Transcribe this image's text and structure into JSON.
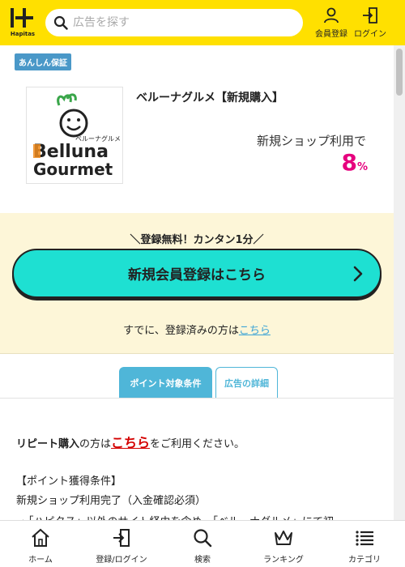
{
  "header": {
    "logo_text": "Hapitas",
    "search_placeholder": "広告を探す",
    "register_label": "会員登録",
    "login_label": "ログイン"
  },
  "ad": {
    "badge": "あんしん保証",
    "shop_name": "ベルーナグルメ【新規購入】",
    "logo": {
      "kana": "ベルーナグルメ",
      "line1": "Belluna",
      "line2": "Gourmet"
    },
    "rate_label": "新規ショップ利用で",
    "rate_value": "8",
    "rate_unit": "%"
  },
  "register": {
    "free_text": "＼登録無料！カンタン1分／",
    "button_label": "新規会員登録はこちら",
    "already_text": "すでに、登録済みの方は",
    "already_link": "こちら"
  },
  "tabs": [
    {
      "label": "ポイント対象条件",
      "active": true
    },
    {
      "label": "広告の詳細",
      "active": false
    }
  ],
  "content": {
    "repeat_strong": "リピート購入",
    "repeat_mid": "の方は",
    "repeat_link": "こちら",
    "repeat_tail": "をご利用ください。",
    "cond_heading": "【ポイント獲得条件】",
    "cond_line": "新規ショップ利用完了（入金確認必須）",
    "cond_bullet": "・「ハピタス」以外のサイト経由を含め、「ベルーナグルメ」にて初"
  },
  "bottom_nav": [
    {
      "label": "ホーム",
      "icon": "home-icon"
    },
    {
      "label": "登録/ログイン",
      "icon": "login-icon"
    },
    {
      "label": "検索",
      "icon": "search-icon"
    },
    {
      "label": "ランキング",
      "icon": "crown-icon"
    },
    {
      "label": "カテゴリ",
      "icon": "list-icon"
    }
  ],
  "colors": {
    "header_bg": "#ffe000",
    "accent_pink": "#e6007e",
    "button_teal": "#1ee0d2",
    "tab_blue": "#4fb6d8",
    "link_blue": "#3aa3d6",
    "badge_blue": "#4a98c8"
  }
}
